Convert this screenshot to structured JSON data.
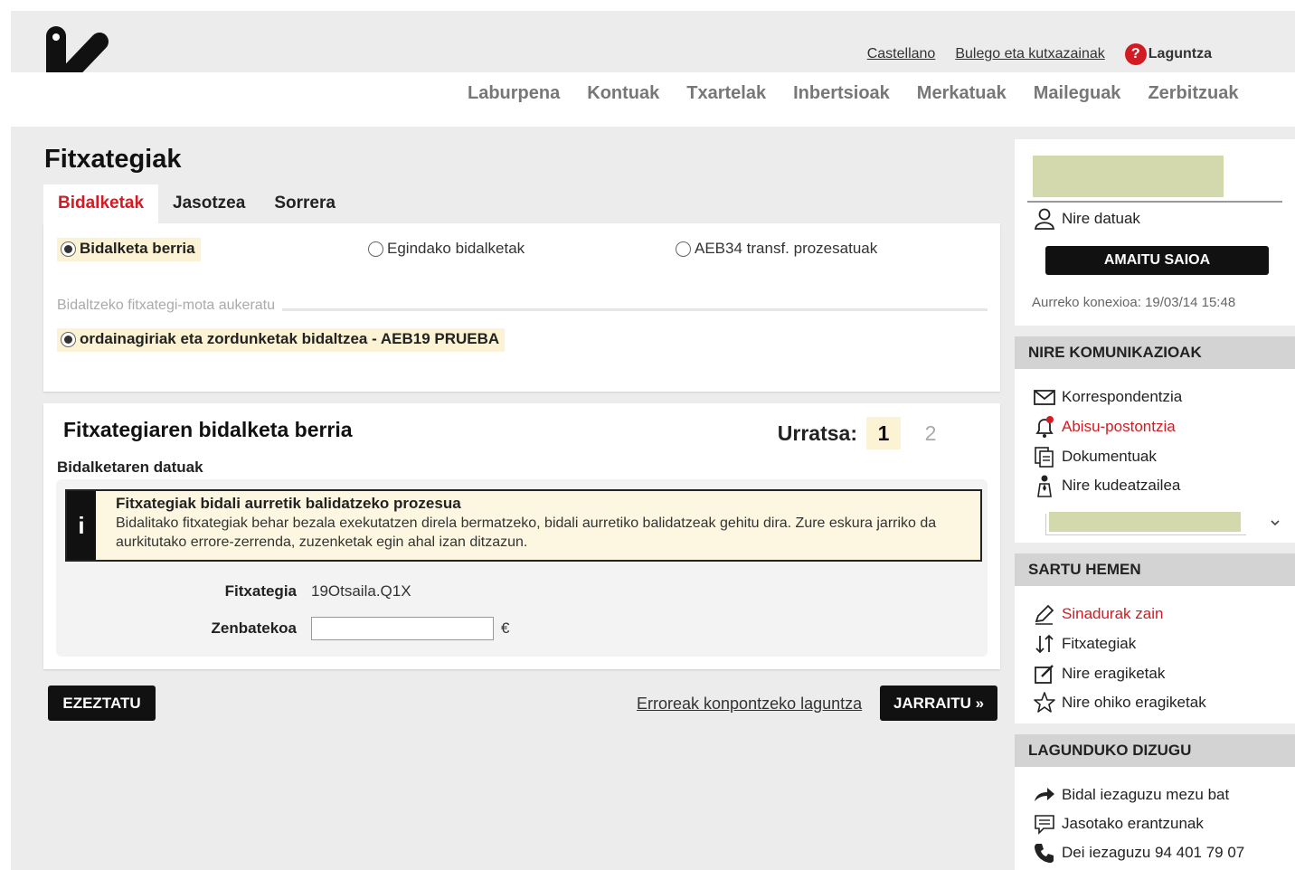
{
  "brand": {
    "name": "kutxabank",
    "accent": "#d21b22"
  },
  "top_links": {
    "language": "Castellano",
    "offices": "Bulego eta kutxazainak",
    "help": "Laguntza"
  },
  "nav": [
    "Laburpena",
    "Kontuak",
    "Txartelak",
    "Inbertsioak",
    "Merkatuak",
    "Maileguak",
    "Zerbitzuak"
  ],
  "page_title": "Fitxategiak",
  "tabs": [
    "Bidalketak",
    "Jasotzea",
    "Sorrera"
  ],
  "send_options": [
    "Bidalketa berria",
    "Egindako bidalketak",
    "AEB34 transf. prozesatuak"
  ],
  "file_type": {
    "legend": "Bidaltzeko fitxategi-mota aukeratu",
    "option": "ordainagiriak eta zordunketak bidaltzea - AEB19 PRUEBA"
  },
  "form": {
    "title": "Fitxategiaren bidalketa berria",
    "step_label": "Urratsa:",
    "step_current": "1",
    "step_next": "2",
    "subtitle": "Bidalketaren datuak",
    "info_icon": "i",
    "info_title": "Fitxategiak bidali aurretik balidatzeko prozesua",
    "info_body": "Bidalitako fitxategiak behar bezala exekutatzen direla bermatzeko, bidali aurretiko balidatzeak gehitu dira. Zure eskura jarriko da aurkitutako errore-zerrenda, zuzenketak egin ahal izan ditzazun.",
    "file_label": "Fitxategia",
    "file_value": "19Otsaila.Q1X",
    "amount_label": "Zenbatekoa",
    "amount_value": "",
    "currency": "€"
  },
  "actions": {
    "cancel": "EZEZTATU",
    "help_link": "Erroreak konpontzeko laguntza",
    "continue": "JARRAITU »"
  },
  "sidebar": {
    "my_data": "Nire datuak",
    "logout": "AMAITU SAIOA",
    "last_connection": "Aurreko konexioa: 19/03/14 15:48",
    "communications_title": "NIRE KOMUNIKAZIOAK",
    "communications": [
      "Korrespondentzia",
      "Abisu-postontzia",
      "Dokumentuak",
      "Nire kudeatzailea"
    ],
    "enter_title": "SARTU HEMEN",
    "enter_items": [
      "Sinadurak zain",
      "Fitxategiak",
      "Nire eragiketak",
      "Nire ohiko eragiketak"
    ],
    "help_title": "LAGUNDUKO DIZUGU",
    "help_items": [
      "Bidal iezaguzu mezu bat",
      "Jasotako erantzunak",
      "Dei iezaguzu 94 401 79 07"
    ]
  }
}
